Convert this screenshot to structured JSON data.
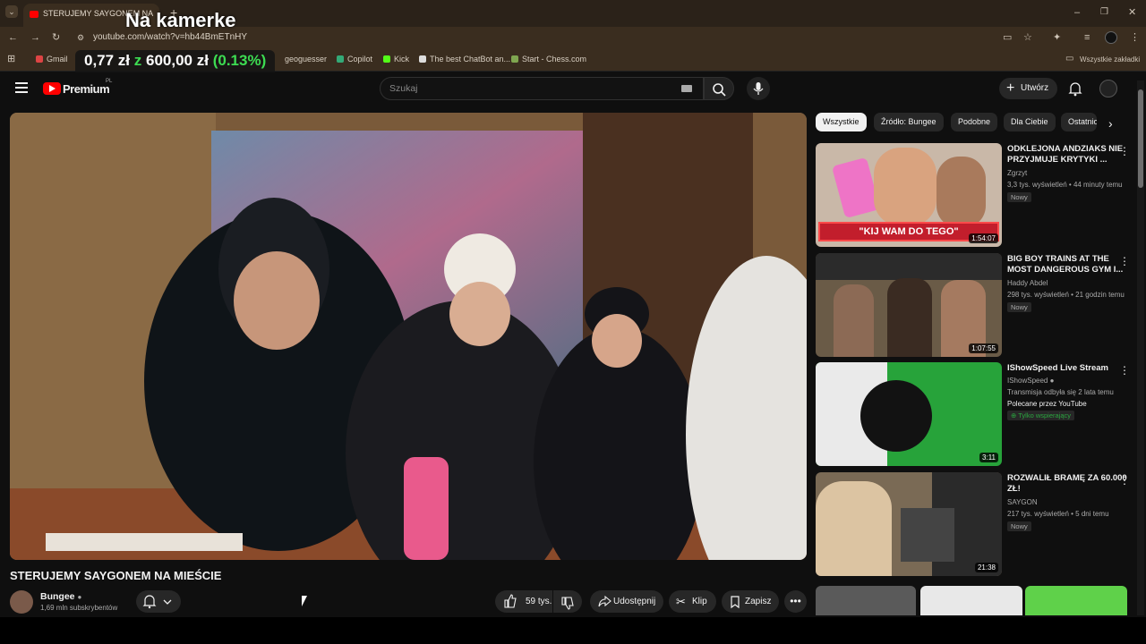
{
  "browser": {
    "tab_title": "STERUJEMY SAYGONEM NA",
    "url": "youtube.com/watch?v=hb44BmETnHY",
    "bookmarks": [
      "Gmail",
      "geoguesser",
      "Copilot",
      "Kick",
      "The best ChatBot an...",
      "Start - Chess.com"
    ],
    "all_bookmarks": "Wszystkie zakładki"
  },
  "overlay": {
    "title": "Na kamerke",
    "ticker_a": "0,77 zł",
    "ticker_z": "z",
    "ticker_b": "600,00 zł",
    "ticker_pct": "(0.13%)"
  },
  "youtube": {
    "logo_text": "Premium",
    "logo_sup": "PL",
    "search_placeholder": "Szukaj",
    "create_label": "Utwórz",
    "chips": [
      "Wszystkie",
      "Źródło: Bungee",
      "Podobne",
      "Dla Ciebie",
      "Ostatnio"
    ]
  },
  "video": {
    "title": "STERUJEMY SAYGONEM NA MIEŚCIE",
    "channel": "Bungee",
    "subscribers": "1,69 mln subskrybentów",
    "likes": "59 tys.",
    "share": "Udostępnij",
    "clip": "Klip",
    "save": "Zapisz"
  },
  "recommendations": [
    {
      "title": "ODKLEJONA ANDZIAKS NIE PRZYJMUJE KRYTYKI ...",
      "channel": "Zgrzyt",
      "meta": "3,3 tys. wyświetleń • 44 minuty temu",
      "badge": "Nowy",
      "duration": "1:54:07",
      "thumb_text": "\"KIJ WAM DO TEGO\"",
      "color": "#c21e2c"
    },
    {
      "title": "BIG BOY TRAINS AT THE MOST DANGEROUS GYM I...",
      "channel": "Haddy Abdel",
      "meta": "298 tys. wyświetleń • 21 godzin temu",
      "badge": "Nowy",
      "duration": "1:07:55",
      "color": "#6a5b47"
    },
    {
      "title": "IShowSpeed Live Stream",
      "channel": "IShowSpeed",
      "meta": "Transmisja odbyła się 2 lata temu",
      "extra": "Polecane przez YouTube",
      "member": "Tylko wspierający",
      "duration": "3:11",
      "color": "#27a33a"
    },
    {
      "title": "ROZWALIŁ BRAMĘ ZA 60.000 ZŁ!",
      "channel": "SAYGON",
      "meta": "217 tys. wyświetleń • 5 dni temu",
      "badge": "Nowy",
      "duration": "21:38",
      "color": "#7a6a55"
    }
  ]
}
